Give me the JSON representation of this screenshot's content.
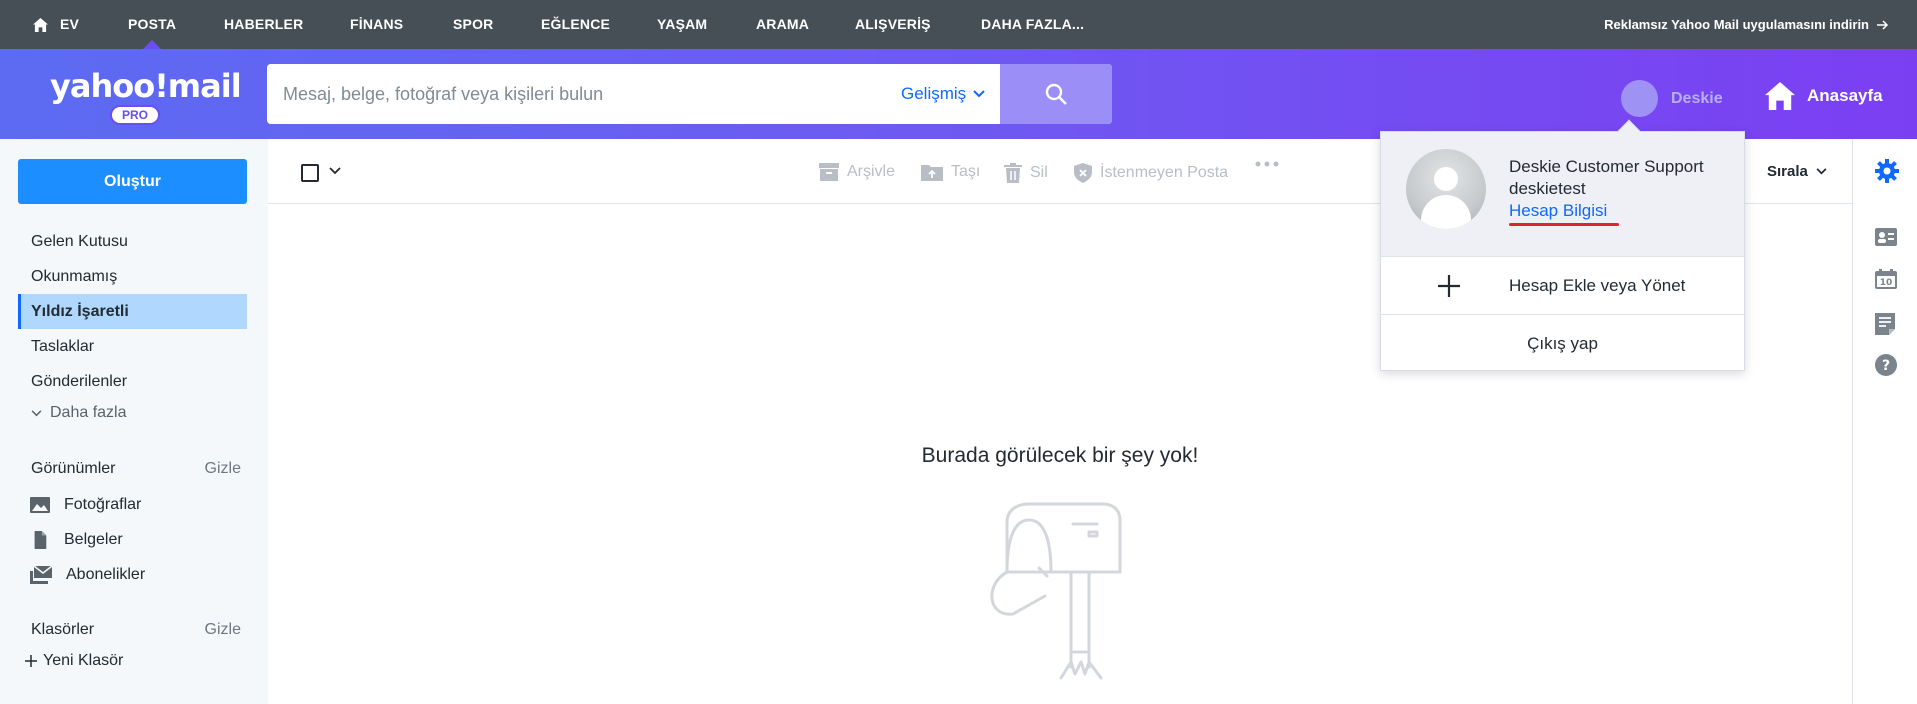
{
  "topnav": {
    "items": [
      "EV",
      "POSTA",
      "HABERLER",
      "FİNANS",
      "SPOR",
      "EĞLENCE",
      "YAŞAM",
      "ARAMA",
      "ALIŞVERİŞ",
      "DAHA FAZLA..."
    ],
    "active": "POSTA",
    "promo": "Reklamsız Yahoo Mail uygulamasını indirin"
  },
  "header": {
    "logo": "yahoo!mail",
    "logo_badge": "PRO",
    "search_placeholder": "Mesaj, belge, fotoğraf veya kişileri bulun",
    "advanced": "Gelişmiş",
    "profile_name": "Deskie",
    "home": "Anasayfa"
  },
  "sidebar": {
    "compose": "Oluştur",
    "folders": [
      "Gelen Kutusu",
      "Okunmamış",
      "Yıldız İşaretli",
      "Taslaklar",
      "Gönderilenler"
    ],
    "selected": "Yıldız İşaretli",
    "more": "Daha fazla",
    "views_title": "Görünümler",
    "views_hide": "Gizle",
    "views": [
      "Fotoğraflar",
      "Belgeler",
      "Abonelikler"
    ],
    "folders_title": "Klasörler",
    "folders_hide": "Gizle",
    "new_folder": "Yeni Klasör"
  },
  "toolbar": {
    "archive": "Arşivle",
    "move": "Taşı",
    "delete": "Sil",
    "spam": "İstenmeyen Posta",
    "sort": "Sırala"
  },
  "main": {
    "empty_message": "Burada görülecek bir şey yok!"
  },
  "account_menu": {
    "name": "Deskie Customer Support",
    "username": "deskietest",
    "account_info": "Hesap Bilgisi",
    "add_manage": "Hesap Ekle veya Yönet",
    "logout": "Çıkış yap"
  },
  "colors": {
    "topnav_bg": "#464e56",
    "header_gradient": [
      "#5c6bf2",
      "#7b3ff2"
    ],
    "compose": "#1d8eff",
    "selected_folder": "#b0d8fe",
    "link": "#0f69ff",
    "underline": "#e0242d"
  }
}
